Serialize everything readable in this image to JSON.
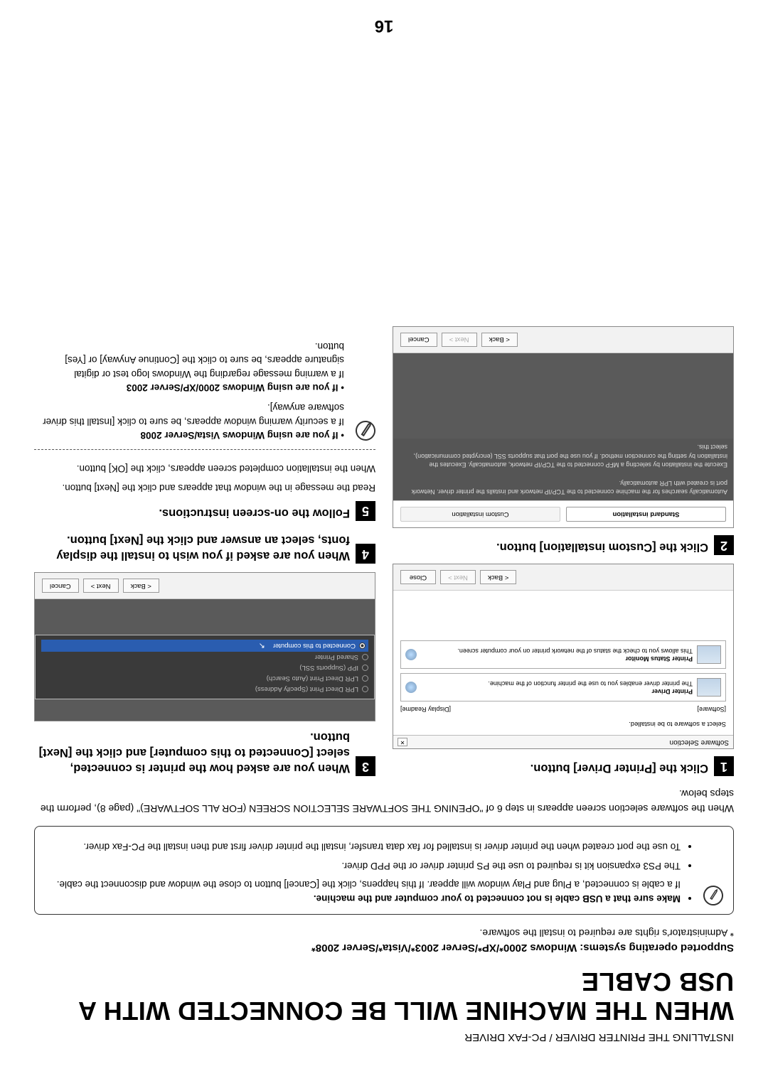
{
  "header": "INSTALLING THE PRINTER DRIVER / PC-FAX DRIVER",
  "title": "WHEN THE MACHINE WILL BE CONNECTED WITH A USB CABLE",
  "subtitle": "Supported operating systems: Windows 2000*/XP*/Server 2003*/Vista*/Server 2008*",
  "note": "* Administrator's rights are required to install the software.",
  "callout": {
    "item1_bold": "Make sure that a USB cable is not connected to your computer and the machine.",
    "item1_rest": "If a cable is connected, a Plug and Play window will appear. If this happens, click the [Cancel] button to close the window and disconnect the cable.",
    "item2": "The PS3 expansion kit is required to use the PS printer driver or the PPD driver.",
    "item3": "To use the port created when the printer driver is installed for fax data transfer, install the printer driver first and then install the PC-Fax driver."
  },
  "intro": "When the software selection screen appears in step 6 of \"OPENING THE SOFTWARE SELECTION SCREEN (FOR ALL SOFTWARE)\" (page 8), perform the steps below.",
  "step1": {
    "text": "Click the [Printer Driver] button."
  },
  "ss1": {
    "title": "Software Selection",
    "sub": "Select a software to be installed.",
    "lbl_software": "[Software]",
    "lbl_readme": "[Display Readme]",
    "row1_title": "Printer Driver",
    "row1_desc": "The printer driver enables you to use the printer function of the machine.",
    "row2_title": "Printer Status Monitor",
    "row2_desc": "This allows you to check the status of the network printer on your computer screen.",
    "back": "< Back",
    "next": "Next >",
    "close": "Close"
  },
  "step2": {
    "text": "Click the [Custom installation] button."
  },
  "ss2": {
    "opt1": "Standard installation",
    "opt1_desc": "Automatically searches for the machine connected to the TCP/IP network and installs the printer driver. Network port is created with LPR automatically.",
    "opt2": "Custom installation",
    "opt2_desc": "Execute the installation by selecting a MFP connected to the TCP/IP network, automatically. Executes the installation by setting the connection method. If you use the port that supports SSL (encrypted communication), select this.",
    "back": "< Back",
    "next": "Next >",
    "cancel": "Cancel"
  },
  "step3": {
    "text": "When you are asked how the printer is connected, select [Connected to this computer] and click the [Next] button."
  },
  "ss3": {
    "r1": "LPR Direct Print (Specify Address)",
    "r2": "LPR Direct Print (Auto Search)",
    "r3": "IPP (Supports SSL)",
    "r4": "Shared Printer",
    "r5": "Connected to this computer",
    "back": "< Back",
    "next": "Next >",
    "cancel": "Cancel"
  },
  "step4": {
    "text": "When you are asked if you wish to install the display fonts, select an answer and click the [Next] button."
  },
  "step5": {
    "text": "Follow the on-screen instructions."
  },
  "step5_p1": "Read the message in the window that appears and click the [Next] button.",
  "step5_p2": "When the installation completed screen appears, click the [OK] button.",
  "os1_bold": "If you are using Windows Vista/Server 2008",
  "os1_rest": "If a security warning window appears, be sure to click [Install this driver software anyway].",
  "os2_bold": "If you are using Windows 2000/XP/Server 2003",
  "os2_rest": "If a warning message regarding the Windows logo test or digital signature appears, be sure to click the [Continue Anyway] or [Yes] button.",
  "pagenum": "16"
}
